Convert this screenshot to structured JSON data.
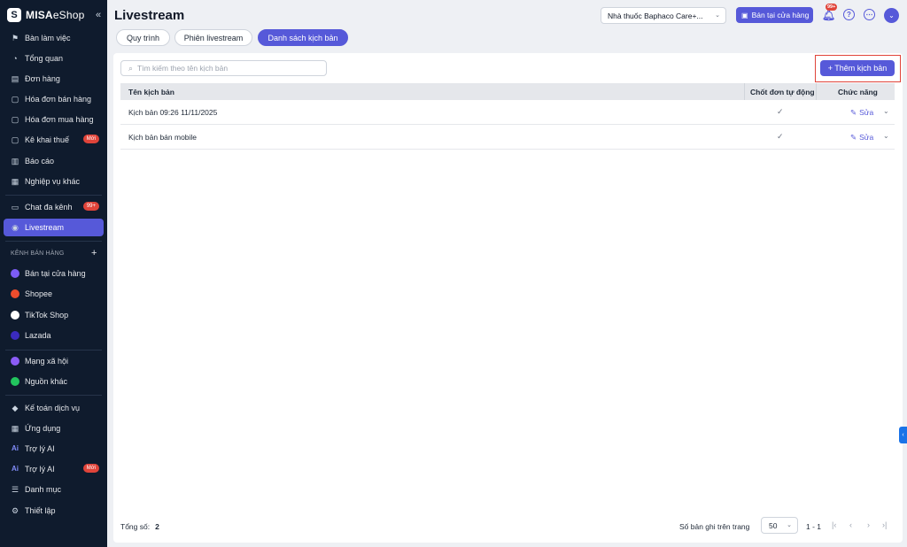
{
  "brand": {
    "name_bold": "MISA",
    "name_light": "eShop",
    "logo_letter": "S",
    "collapse_icon": "double-chevron-left"
  },
  "sidebar": {
    "items": [
      {
        "label": "Bàn làm việc",
        "icon": "desk-icon",
        "glyph": "⚑"
      },
      {
        "label": "Tổng quan",
        "icon": "gauge-icon",
        "glyph": "◔"
      },
      {
        "label": "Đơn hàng",
        "icon": "order-icon",
        "glyph": "▤"
      },
      {
        "label": "Hóa đơn bán hàng",
        "icon": "invoice-icon",
        "glyph": "▢"
      },
      {
        "label": "Hóa đơn mua hàng",
        "icon": "purchase-invoice-icon",
        "glyph": "▢"
      },
      {
        "label": "Kê khai thuế",
        "icon": "tax-icon",
        "glyph": "▢",
        "badge": "Mới"
      },
      {
        "label": "Báo cáo",
        "icon": "chart-icon",
        "glyph": "▥"
      },
      {
        "label": "Nghiệp vụ khác",
        "icon": "grid-icon",
        "glyph": "▦"
      },
      {
        "label": "Chat đa kênh",
        "icon": "chat-icon",
        "glyph": "▭",
        "badge": "99+"
      },
      {
        "label": "Livestream",
        "icon": "broadcast-icon",
        "glyph": "◉",
        "active": true
      }
    ],
    "section_title": "KÊNH BÁN HÀNG",
    "section_add": "+",
    "channels": [
      {
        "label": "Bán tại cửa hàng",
        "icon": "store-icon",
        "color": "#7c5cf5"
      },
      {
        "label": "Shopee",
        "icon": "shopee-icon",
        "color": "#ee4d2d"
      },
      {
        "label": "TikTok Shop",
        "icon": "tiktok-icon",
        "color": "#ffffff"
      },
      {
        "label": "Lazada",
        "icon": "lazada-icon",
        "color": "#3b2bbf"
      }
    ],
    "others": [
      {
        "label": "Mạng xã hội",
        "icon": "social-icon",
        "color": "#8b5cf6"
      },
      {
        "label": "Nguồn khác",
        "icon": "other-source-icon",
        "color": "#22c55e"
      }
    ],
    "bottom": [
      {
        "label": "Kế toán dịch vụ",
        "icon": "accounting-icon",
        "glyph": "◆"
      },
      {
        "label": "Ứng dụng",
        "icon": "apps-icon",
        "glyph": "▦"
      },
      {
        "label": "Trợ lý AI",
        "icon": "ai-icon",
        "glyph": "Ai"
      },
      {
        "label": "Trợ lý AI",
        "icon": "ai-icon",
        "glyph": "Ai",
        "badge": "Mới"
      },
      {
        "label": "Danh mục",
        "icon": "list-icon",
        "glyph": "☰"
      },
      {
        "label": "Thiết lập",
        "icon": "settings-icon",
        "glyph": "⚙"
      }
    ]
  },
  "header": {
    "title": "Livestream",
    "store_select": "Nhà thuốc Baphaco Care+...",
    "pos_button": "Bán tại cửa hàng",
    "notif_badge": "99+",
    "help": "?",
    "more": "⋯",
    "avatar": "⌄"
  },
  "tabs": [
    {
      "label": "Quy trình"
    },
    {
      "label": "Phiên livestream"
    },
    {
      "label": "Danh sách kịch bản",
      "active": true
    }
  ],
  "toolbar": {
    "search_placeholder": "Tìm kiếm theo tên kịch bản",
    "add_button": "+ Thêm kịch bản"
  },
  "table": {
    "columns": [
      "Tên kịch bản",
      "Chốt đơn tự động",
      "Chức năng"
    ],
    "rows": [
      {
        "name": "Kịch bản 09:26 11/11/2025",
        "auto_close": "✓",
        "action": "Sửa"
      },
      {
        "name": "Kịch bản bán mobile",
        "auto_close": "✓",
        "action": "Sửa"
      }
    ]
  },
  "footer": {
    "total_label": "Tổng số:",
    "total_value": "2",
    "per_page_label": "Số bản ghi trên trang",
    "per_page_value": "50",
    "range": "1 - 1"
  }
}
